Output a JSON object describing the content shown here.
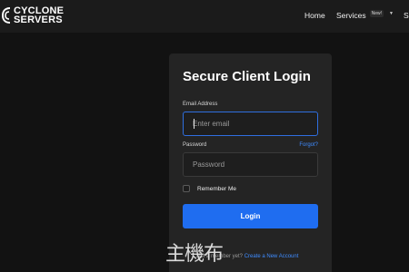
{
  "header": {
    "logo": {
      "line1": "CYCLONE",
      "line2": "SERVERS",
      "icon": "cyclone-logo-icon"
    },
    "nav": {
      "home": "Home",
      "services": "Services",
      "services_badge": "New!",
      "cut_item": "S"
    }
  },
  "login": {
    "title": "Secure Client Login",
    "email_label": "Email Address",
    "email_placeholder": "Enter email",
    "password_label": "Password",
    "forgot": "Forgot?",
    "password_placeholder": "Password",
    "remember": "Remember Me",
    "button": "Login",
    "signup_prefix": "Not a member yet?",
    "signup_link": "Create a New Account"
  },
  "watermark": "主機布",
  "colors": {
    "accent": "#1f6df0",
    "link": "#3f8cff",
    "background": "#121212",
    "card": "#242424"
  }
}
